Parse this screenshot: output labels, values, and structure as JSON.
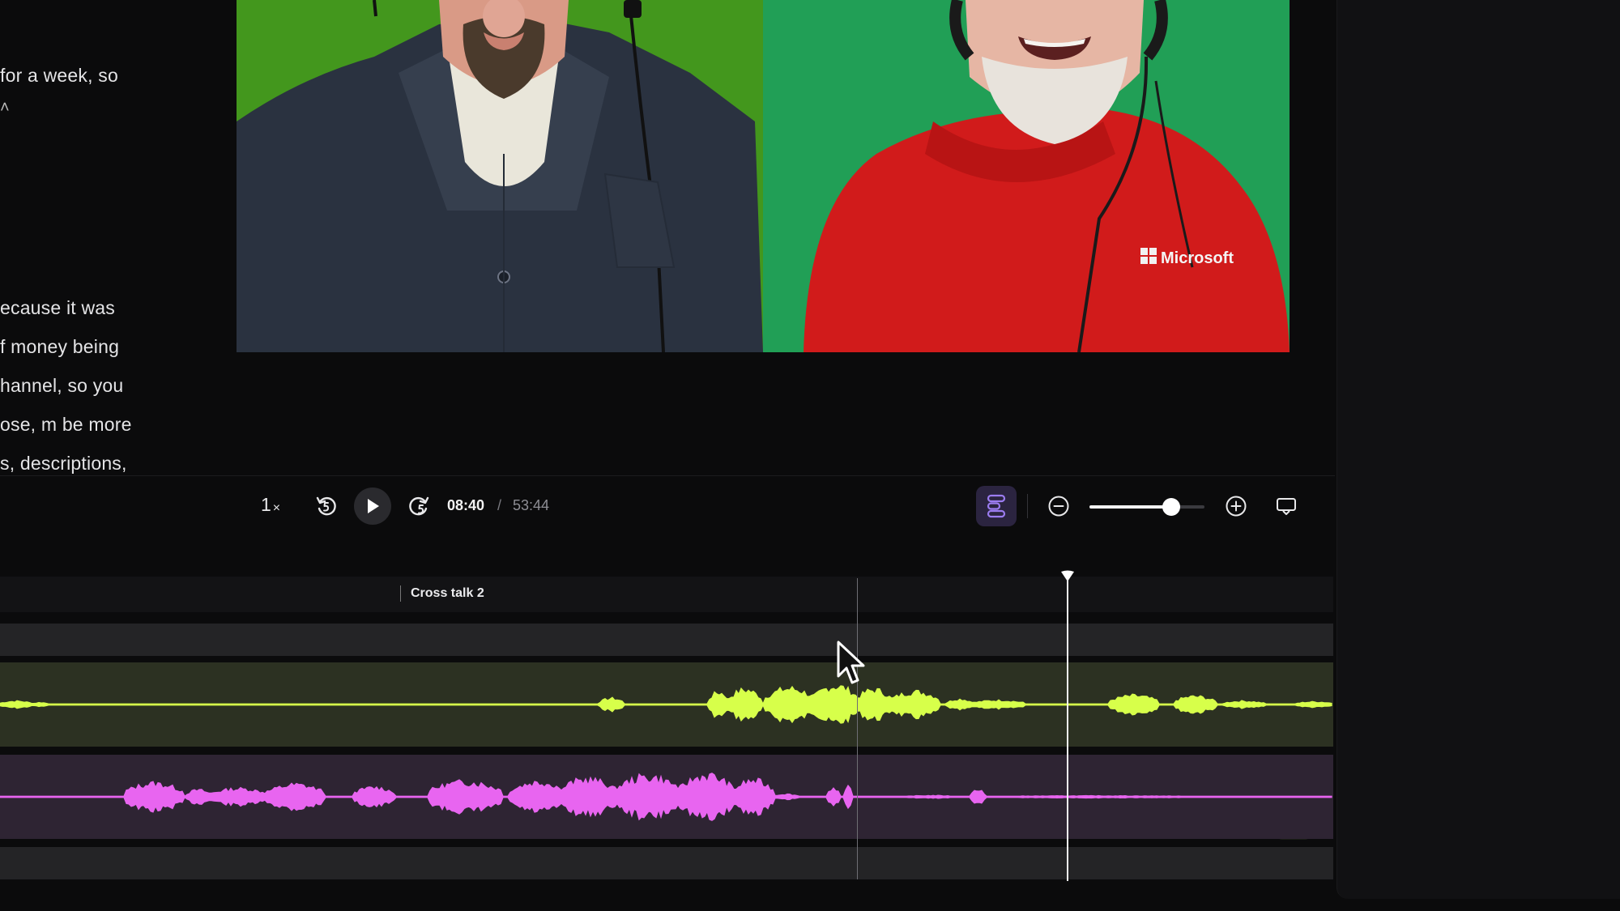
{
  "transcript": {
    "lines": [
      "for a week, so",
      "˄",
      "ecause it was",
      "f money being",
      "hannel, so you",
      "ose, m be more",
      "s, descriptions,"
    ]
  },
  "video": {
    "shirt_logo_text": "Microsoft"
  },
  "player": {
    "speed_value": "1",
    "speed_suffix": "×",
    "current_time": "08:40",
    "separator": "/",
    "total_time": "53:44",
    "zoom_level": 0.71
  },
  "timeline": {
    "marker_label": "Cross talk 2"
  },
  "colors": {
    "track_green": "#d7ff4a",
    "track_pink": "#e865f0",
    "accent_purple": "#9b7cf0"
  },
  "icons": {
    "rewind": "rewind-5-icon",
    "play": "play-icon",
    "forward": "forward-5-icon",
    "layout": "layout-transcript-icon",
    "zoom_out": "zoom-out-icon",
    "zoom_in": "zoom-in-icon",
    "screen": "screen-icon",
    "add": "plus-icon",
    "cursor": "mouse-cursor-icon"
  }
}
